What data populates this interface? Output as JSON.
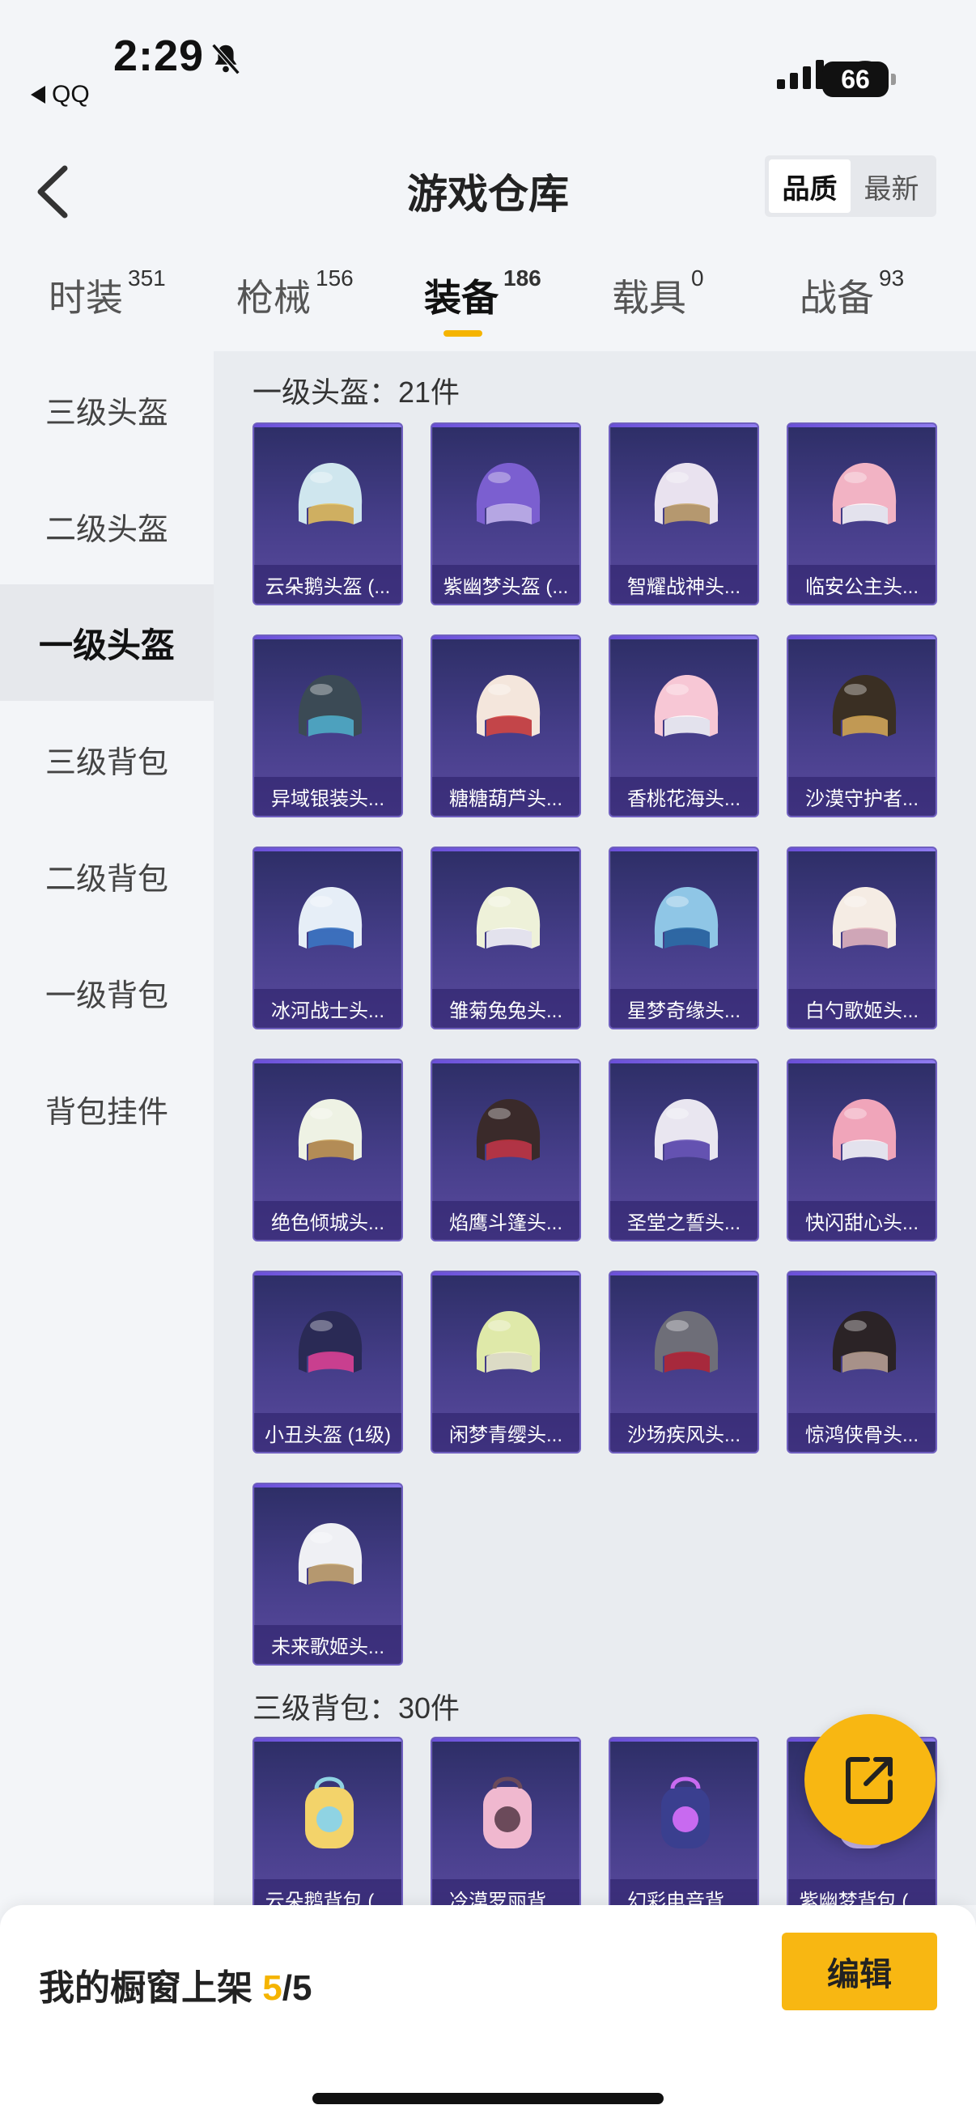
{
  "status_bar": {
    "time": "2:29",
    "back_app": "QQ",
    "battery": "66"
  },
  "nav": {
    "title": "游戏仓库",
    "sort_options": [
      "品质",
      "最新"
    ],
    "sort_active": "品质"
  },
  "tabs": [
    {
      "label": "时装",
      "count": "351"
    },
    {
      "label": "枪械",
      "count": "156"
    },
    {
      "label": "装备",
      "count": "186",
      "active": true
    },
    {
      "label": "载具",
      "count": "0"
    },
    {
      "label": "战备",
      "count": "93"
    }
  ],
  "sidebar": {
    "items": [
      {
        "label": "三级头盔"
      },
      {
        "label": "二级头盔"
      },
      {
        "label": "一级头盔",
        "active": true
      },
      {
        "label": "三级背包"
      },
      {
        "label": "二级背包"
      },
      {
        "label": "一级背包"
      },
      {
        "label": "背包挂件"
      }
    ]
  },
  "sections": [
    {
      "title": "一级头盔：21件",
      "items": [
        {
          "label": "云朵鹅头盔 (...",
          "color": "#cfe6ee",
          "accent": "#e8c35a"
        },
        {
          "label": "紫幽梦头盔 (...",
          "color": "#7b5fd0",
          "accent": "#c9b8f3"
        },
        {
          "label": "智耀战神头...",
          "color": "#e9e2ef",
          "accent": "#c9a86b"
        },
        {
          "label": "临安公主头...",
          "color": "#f2b3c4",
          "accent": "#ffffff"
        },
        {
          "label": "异域银装头...",
          "color": "#3b4a55",
          "accent": "#4fb3c8"
        },
        {
          "label": "糖糖葫芦头...",
          "color": "#f4e6dc",
          "accent": "#d9463e"
        },
        {
          "label": "香桃花海头...",
          "color": "#f7c7d5",
          "accent": "#ffffff"
        },
        {
          "label": "沙漠守护者...",
          "color": "#3a2f23",
          "accent": "#d7a94b"
        },
        {
          "label": "冰河战士头...",
          "color": "#e6eef7",
          "accent": "#3b78c6"
        },
        {
          "label": "雏菊兔兔头...",
          "color": "#eef1d9",
          "accent": "#ffffff"
        },
        {
          "label": "星梦奇缘头...",
          "color": "#8fc6e6",
          "accent": "#2a6fa8"
        },
        {
          "label": "白勺歌姬头...",
          "color": "#f5ece4",
          "accent": "#e8b8c0"
        },
        {
          "label": "绝色倾城头...",
          "color": "#eef2e4",
          "accent": "#c79a4e"
        },
        {
          "label": "焰鹰斗篷头...",
          "color": "#3a2a2a",
          "accent": "#c4323a"
        },
        {
          "label": "圣堂之誓头...",
          "color": "#e9e6f0",
          "accent": "#6a56b8"
        },
        {
          "label": "快闪甜心头...",
          "color": "#f0a5ba",
          "accent": "#ffffff"
        },
        {
          "label": "小丑头盔 (1级)",
          "color": "#2a2a55",
          "accent": "#e04090"
        },
        {
          "label": "闲梦青缨头...",
          "color": "#dfe9a9",
          "accent": "#f7f7d0"
        },
        {
          "label": "沙场疾风头...",
          "color": "#6e6e78",
          "accent": "#b9262f"
        },
        {
          "label": "惊鸿侠骨头...",
          "color": "#2b2326",
          "accent": "#b8a08a"
        },
        {
          "label": "未来歌姬头...",
          "color": "#eff0f4",
          "accent": "#c9a86b"
        }
      ]
    },
    {
      "title": "三级背包：30件",
      "items": [
        {
          "label": "云朵鹅背包 (...",
          "color": "#f3d36a",
          "accent": "#8fd3e3"
        },
        {
          "label": "冷漠罗丽背...",
          "color": "#f0b8cf",
          "accent": "#6b4a5a"
        },
        {
          "label": "幻彩电音背...",
          "color": "#3a3f8f",
          "accent": "#c86af0"
        },
        {
          "label": "紫幽梦背包 (...",
          "color": "#c9b8f3",
          "accent": "#f1e6d0"
        }
      ]
    }
  ],
  "bottom_bar": {
    "showcase_label": "我的橱窗上架",
    "showcase_current": "5",
    "showcase_total": "/5",
    "edit_label": "编辑"
  }
}
